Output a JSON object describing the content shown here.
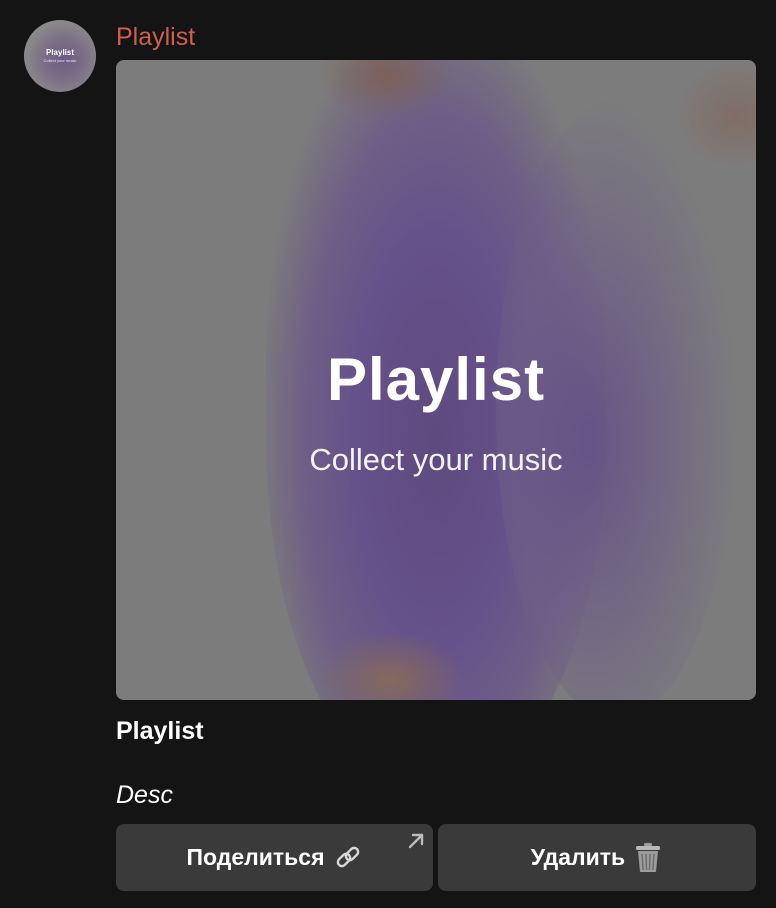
{
  "message": {
    "sender": "Playlist",
    "avatar": {
      "title": "Playlist",
      "subtitle": "Collect your music"
    },
    "cover": {
      "title": "Playlist",
      "subtitle": "Collect your music"
    },
    "playlist_name": "Playlist",
    "description": "Desc"
  },
  "buttons": {
    "share_label": "Поделиться",
    "share_icon": "link-icon",
    "delete_label": "Удалить",
    "delete_icon": "trash-icon"
  },
  "colors": {
    "background": "#141414",
    "sender": "#cf5f4e",
    "button": "#3a3a3a"
  }
}
